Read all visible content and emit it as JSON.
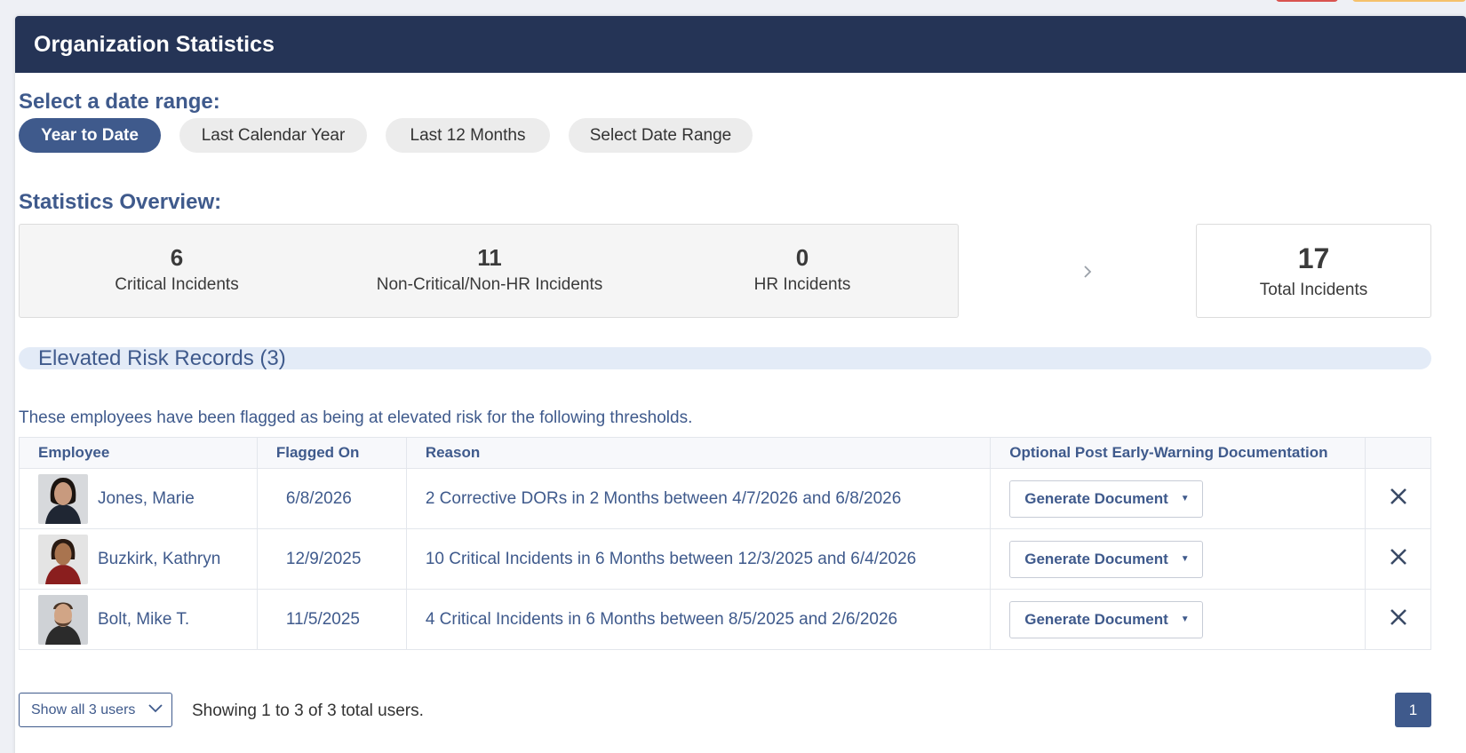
{
  "header": {
    "title": "Organization Statistics"
  },
  "date_range": {
    "heading": "Select a date range:",
    "options": [
      "Year to Date",
      "Last Calendar Year",
      "Last 12 Months",
      "Select Date Range"
    ],
    "selected": "Year to Date"
  },
  "overview": {
    "heading": "Statistics Overview:",
    "stats": [
      {
        "value": "6",
        "label": "Critical Incidents"
      },
      {
        "value": "11",
        "label": "Non-Critical/Non-HR Incidents"
      },
      {
        "value": "0",
        "label": "HR Incidents"
      }
    ],
    "total": {
      "value": "17",
      "label": "Total Incidents"
    }
  },
  "risk": {
    "title": "Elevated Risk Records (3)",
    "description": "These employees have been flagged as being at elevated risk for the following thresholds.",
    "columns": [
      "Employee",
      "Flagged On",
      "Reason",
      "Optional Post Early-Warning Documentation",
      ""
    ],
    "rows": [
      {
        "name": "Jones, Marie",
        "flagged_on": "6/8/2026",
        "reason": "2 Corrective DORs in 2 Months between 4/7/2026 and 6/8/2026",
        "action": "Generate Document"
      },
      {
        "name": "Buzkirk, Kathryn",
        "flagged_on": "12/9/2025",
        "reason": "10 Critical Incidents in 6 Months between 12/3/2025 and 6/4/2026",
        "action": "Generate Document"
      },
      {
        "name": "Bolt, Mike T.",
        "flagged_on": "11/5/2025",
        "reason": "4 Critical Incidents in 6 Months between 8/5/2025 and 2/6/2026",
        "action": "Generate Document"
      }
    ]
  },
  "footer": {
    "select_label": "Show all 3 users",
    "showing_text": "Showing 1 to 3 of 3 total users.",
    "page": "1"
  },
  "colors": {
    "header_bg": "#253456",
    "accent": "#3f5a8c",
    "danger": "#d9534f",
    "warning": "#f5c16b"
  },
  "icons": [
    "chevron-right-icon",
    "caret-down-icon",
    "close-icon",
    "chevron-down-icon"
  ]
}
